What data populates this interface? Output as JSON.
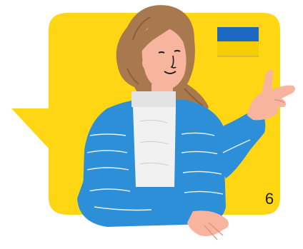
{
  "card": {
    "page_number": "6",
    "background_color": "#FFD614",
    "flag": {
      "country": "Ukraine",
      "colors": [
        "#1F68C1",
        "#F5CD00"
      ]
    },
    "character": {
      "description_icon": "woman-pointing-up-icon",
      "sweater_color": "#2E8FD9",
      "hair_color": "#A8794F",
      "skin_color": "#F7B5A0",
      "shirt_color": "#F1F1F1"
    }
  }
}
